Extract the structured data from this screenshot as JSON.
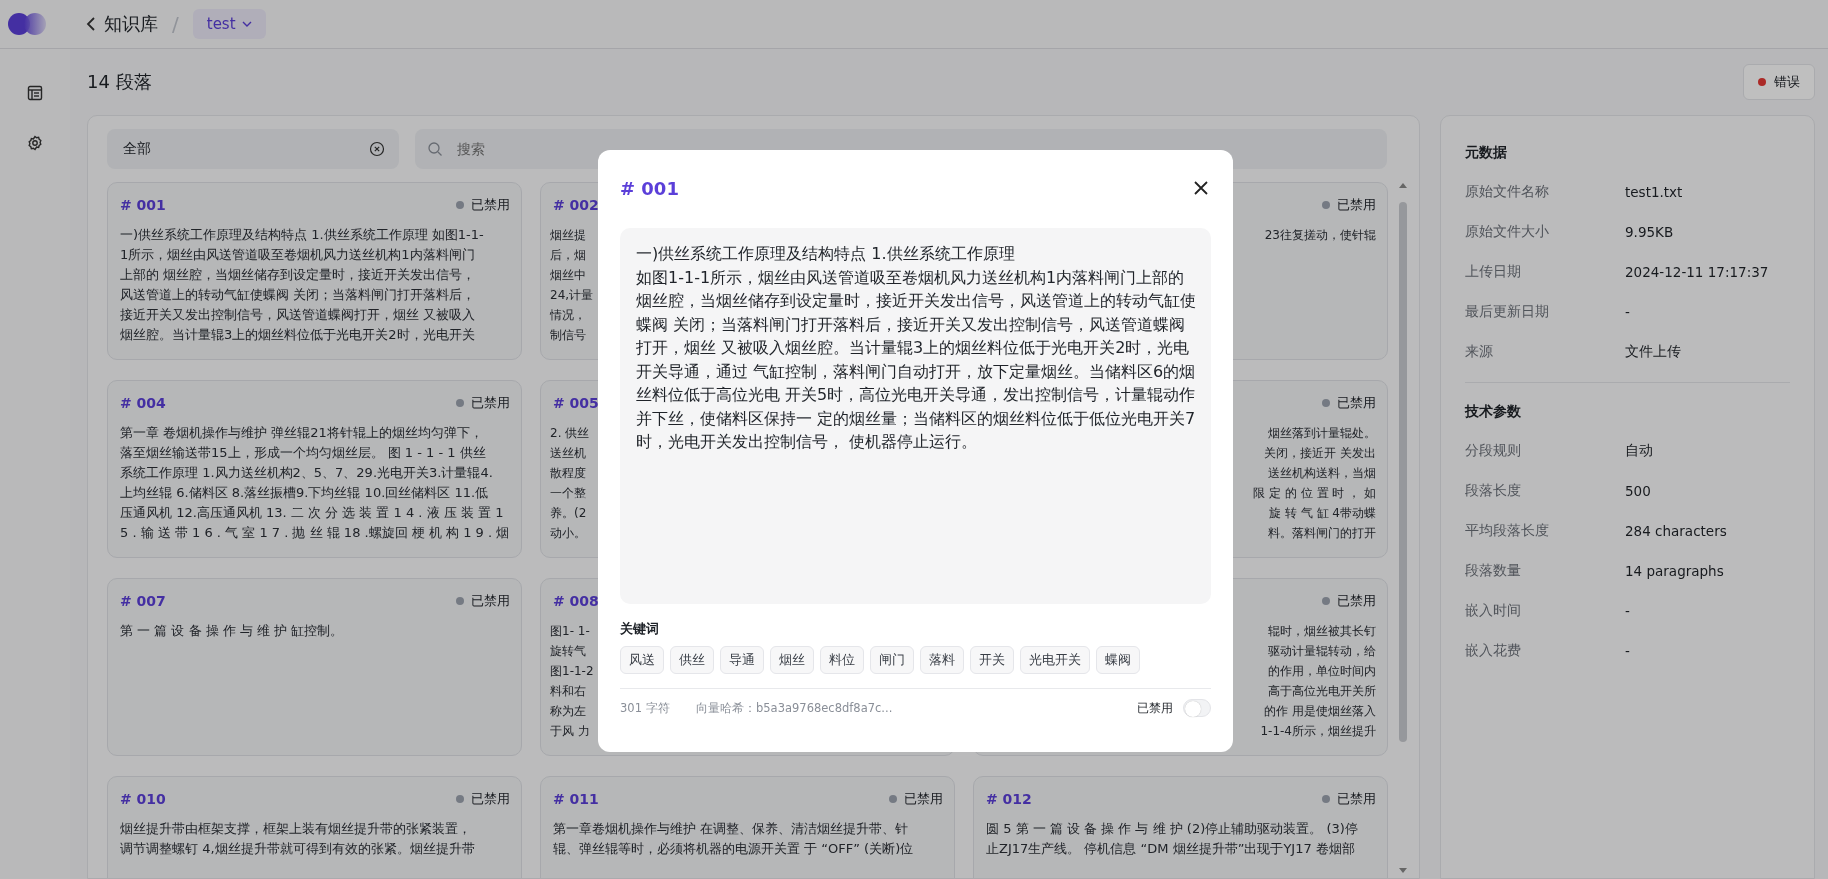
{
  "header": {
    "back_label": "知识库",
    "separator": "/",
    "dataset": "test"
  },
  "sidebar": {
    "items": [
      {
        "kind": "documents",
        "selected": false
      },
      {
        "kind": "settings",
        "selected": false
      }
    ]
  },
  "page": {
    "title": "14 段落",
    "status_button": "错误"
  },
  "filter": {
    "value": "全部",
    "placeholder": "搜索"
  },
  "cards": [
    {
      "kind": "full",
      "number": "# 001",
      "status": "已禁用",
      "enabled": false,
      "lines": [
        "一)供丝系统工作原理及结构特点 1.供丝系统工作原理 如图1-1-",
        "1所示，烟丝由风送管道吸至卷烟机风力送丝机构1内落料闸门",
        "上部的 烟丝腔，当烟丝储存到设定量时，接近开关发出信号，",
        "风送管道上的转动气缸使蝶阀 关闭；当落料闸门打开落料后，",
        "接近开关又发出控制信号，风送管道蝶阀打开，烟丝 又被吸入",
        "烟丝腔。当计量辊3上的烟丝料位低于光电开关2时，光电开关"
      ]
    },
    {
      "kind": "left_strip",
      "number": "# 002",
      "lines": [
        "烟丝提",
        "后，烟",
        "烟丝中",
        "24,计量",
        "情况，",
        "制信号"
      ]
    },
    {
      "kind": "right_strip",
      "status": "已禁用",
      "enabled": false,
      "lines": [
        "23往复搓动，使针辊"
      ]
    },
    {
      "kind": "full",
      "number": "# 004",
      "status": "已禁用",
      "enabled": false,
      "lines": [
        "第一章 卷烟机操作与维护 弹丝辊21将针辊上的烟丝均匀弹下，",
        "落至烟丝输送带15上，形成一个均匀烟丝层。 图 1 - 1 - 1 供丝",
        "系统工作原理 1.风力送丝机构2、5、7、29.光电开关3.计量辊4.",
        "上均丝辊 6.储料区 8.落丝振槽9.下均丝辊 10.回丝储料区 11.低",
        "压通风机 12.高压通风机 13. 二 次 分 选 装 置 1 4 . 液 压 装 置 1",
        "5 . 输 送 带 1 6 . 气 室 1 7 . 抛 丝 辊 18 .螺旋回 梗 机 构 1 9 . 烟"
      ]
    },
    {
      "kind": "left_strip",
      "number": "# 005",
      "lines": [
        "2. 供丝",
        "送丝机",
        "散程度",
        "一个整",
        "养。(2",
        "动小。"
      ]
    },
    {
      "kind": "right_strip",
      "status": "已禁用",
      "enabled": false,
      "lines": [
        "烟丝落到计量辊处。",
        "关闭，接近开 关发出",
        "送丝机构送料，当烟",
        "限 定 的 位 置 时 ， 如",
        "旋 转 气 缸 4带动蝶",
        "料。落料闸门的打开"
      ]
    },
    {
      "kind": "full",
      "number": "# 007",
      "status": "已禁用",
      "enabled": false,
      "lines": [
        "第 一 篇 设 备 操 作 与 维 护 缸控制。"
      ]
    },
    {
      "kind": "left_strip",
      "number": "# 008",
      "lines": [
        "图1- 1-",
        "旋转气",
        "图1-1-2",
        "料和右",
        "称为左",
        "于风 力"
      ]
    },
    {
      "kind": "right_strip",
      "status": "已禁用",
      "enabled": false,
      "lines": [
        "辊时，烟丝被其长钉",
        "驱动计量辊转动，给",
        "的作用，单位时间内",
        "高于高位光电开关所",
        "的作 用是使烟丝落入",
        "1-1-4所示，烟丝提升"
      ]
    },
    {
      "kind": "full",
      "number": "# 010",
      "status": "已禁用",
      "enabled": false,
      "lines": [
        "烟丝提升带由框架支撑，框架上装有烟丝提升带的张紧装置，",
        "调节调整螺钉 4,烟丝提升带就可得到有效的张紧。烟丝提升带"
      ]
    },
    {
      "kind": "full",
      "number": "# 011",
      "status": "已禁用",
      "enabled": false,
      "lines": [
        "第一章卷烟机操作与维护 在调整、保养、清洁烟丝提升带、针",
        "辊、弹丝辊等时，必须将机器的电源开关置 于 “OFF” (关断)位"
      ]
    },
    {
      "kind": "full",
      "number": "# 012",
      "status": "已禁用",
      "enabled": false,
      "lines": [
        "圆 5 第 一 篇 设 备 操 作 与 维 护 (2)停止辅助驱动装置。 (3)停",
        "止ZJ17生产线。 停机信息 “DM 烟丝提升带”出现于YJ17 卷烟部"
      ]
    }
  ],
  "metadata": {
    "sections": [
      {
        "title": "元数据",
        "rows": [
          {
            "label": "原始文件名称",
            "value": "test1.txt"
          },
          {
            "label": "原始文件大小",
            "value": "9.95KB"
          },
          {
            "label": "上传日期",
            "value": "2024-12-11 17:17:37"
          },
          {
            "label": "最后更新日期",
            "value": "-"
          },
          {
            "label": "来源",
            "value": "文件上传"
          }
        ]
      },
      {
        "title": "技术参数",
        "rows": [
          {
            "label": "分段规则",
            "value": "自动"
          },
          {
            "label": "段落长度",
            "value": "500"
          },
          {
            "label": "平均段落长度",
            "value": "284 characters"
          },
          {
            "label": "段落数量",
            "value": "14 paragraphs"
          },
          {
            "label": "嵌入时间",
            "value": "-"
          },
          {
            "label": "嵌入花费",
            "value": "-"
          }
        ]
      }
    ]
  },
  "modal": {
    "title": "# 001",
    "lines": [
      "一)供丝系统工作原理及结构特点 1.供丝系统工作原理",
      "如图1-1-1所示，烟丝由风送管道吸至卷烟机风力送丝机构1内落料闸门上部的烟丝腔，当烟丝储存到设定量时，接近开关发出信号，风送管道上的转动气缸使蝶阀 关闭；当落料闸门打开落料后，接近开关又发出控制信号，风送管道蝶阀打开，烟丝 又被吸入烟丝腔。当计量辊3上的烟丝料位低于光电开关2时，光电开关导通，通过 气缸控制，落料闸门自动打开，放下定量烟丝。当储料区6的烟丝料位低于高位光电 开关5时，高位光电开关导通，发出控制信号，计量辊动作并下丝，使储料区保持一 定的烟丝量；当储料区的烟丝料位低于低位光电开关7时，光电开关发出控制信号， 使机器停止运行。"
    ],
    "keywords_label": "关键词",
    "keywords": [
      "风送",
      "供丝",
      "导通",
      "烟丝",
      "料位",
      "闸门",
      "落料",
      "开关",
      "光电开关",
      "蝶阀"
    ],
    "char_count": "301 字符",
    "hash": "向量哈希：b5a3a9768ec8df8a7c...",
    "toggle_label": "已禁用",
    "on": false
  }
}
